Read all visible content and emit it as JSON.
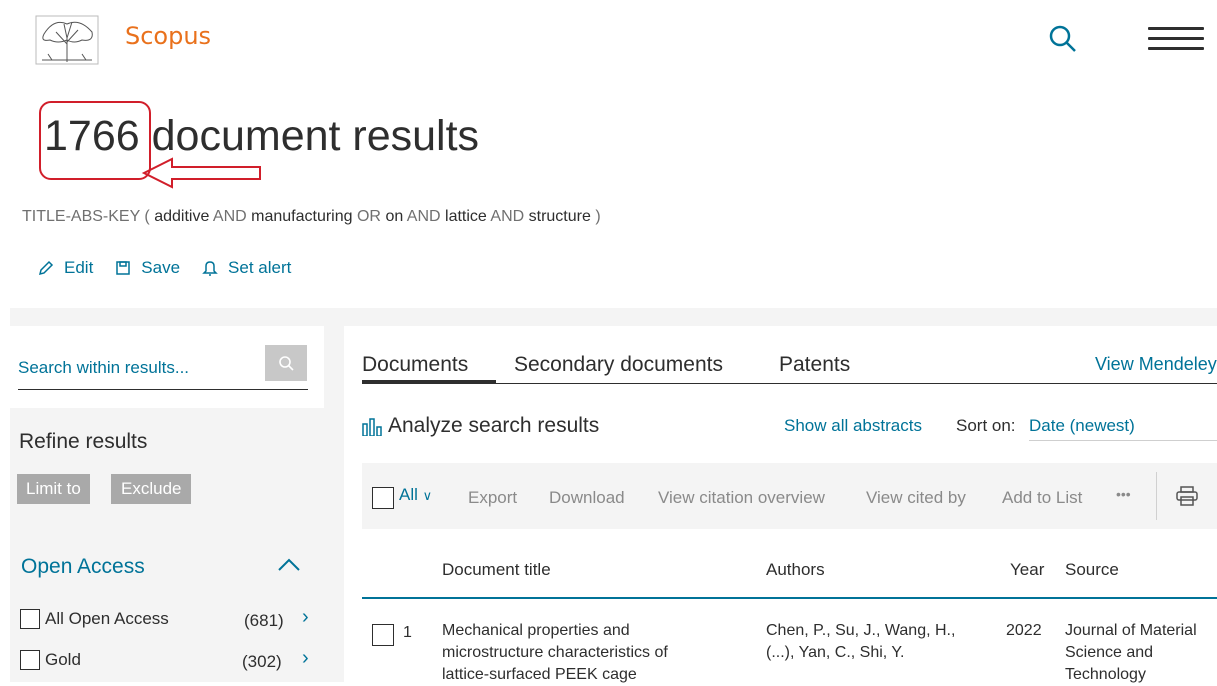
{
  "header": {
    "brand": "Scopus",
    "icons": {
      "logo": "elsevier-tree-logo",
      "search": "search-icon",
      "menu": "hamburger-menu-icon"
    }
  },
  "results": {
    "count": "1766",
    "suffix": "document results"
  },
  "query": {
    "prefix": "TITLE-ABS-KEY (",
    "t1": "additive",
    "op1": "AND",
    "t2": "manufacturing",
    "op2": "OR",
    "t3": "on",
    "op3": "AND",
    "t4": "lattice",
    "op4": "AND",
    "t5": "structure",
    "suffix": ")"
  },
  "actions": {
    "edit": "Edit",
    "save": "Save",
    "alert": "Set alert"
  },
  "sidebar": {
    "search_placeholder": "Search within results...",
    "refine_title": "Refine results",
    "limit_to": "Limit to",
    "exclude": "Exclude",
    "facet_title": "Open Access",
    "facets": [
      {
        "label": "All Open Access",
        "count": "(681)"
      },
      {
        "label": "Gold",
        "count": "(302)"
      }
    ]
  },
  "tabs": {
    "documents": "Documents",
    "secondary": "Secondary documents",
    "patents": "Patents",
    "mendeley": "View Mendeley"
  },
  "analysis": {
    "analyze": "Analyze search results",
    "show_abstracts": "Show all abstracts",
    "sort_label": "Sort on:",
    "sort_value": "Date (newest)"
  },
  "toolbar": {
    "all": "All",
    "export": "Export",
    "download": "Download",
    "citation": "View citation overview",
    "cited_by": "View cited by",
    "add_list": "Add to List",
    "more": "•••"
  },
  "table": {
    "headers": {
      "title": "Document title",
      "authors": "Authors",
      "year": "Year",
      "source": "Source"
    },
    "rows": [
      {
        "index": "1",
        "title_l1": "Mechanical properties and",
        "title_l2": "microstructure characteristics of",
        "title_l3": "lattice-surfaced PEEK cage",
        "authors_l1": "Chen, P., Su, J., Wang, H.,",
        "authors_l2": "(...), Yan, C., Shi, Y.",
        "year": "2022",
        "source_l1": "Journal of Material",
        "source_l2": "Science and",
        "source_l3": "Technology"
      }
    ]
  },
  "colors": {
    "accent": "#007398",
    "brand": "#e9711c",
    "highlight": "#d11e2a"
  }
}
